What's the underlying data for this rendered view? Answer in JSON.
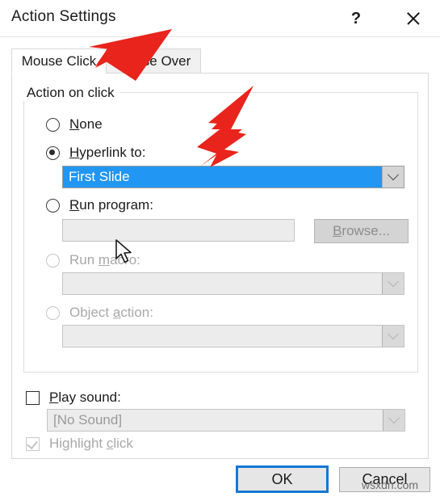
{
  "window": {
    "title": "Action Settings",
    "help_label": "?",
    "close_label": "Close"
  },
  "tabs": [
    {
      "label": "Mouse Click",
      "active": true
    },
    {
      "label": "Mouse Over",
      "active": false
    }
  ],
  "group": {
    "legend": "Action on click"
  },
  "options": [
    {
      "label": "None",
      "accel": "N",
      "selected": false,
      "enabled": true
    },
    {
      "label": "Hyperlink to:",
      "accel": "H",
      "selected": true,
      "enabled": true
    },
    {
      "label": "Run program:",
      "accel": "R",
      "selected": false,
      "enabled": true
    },
    {
      "label": "Run macro:",
      "accel": "m",
      "selected": false,
      "enabled": false
    },
    {
      "label": "Object action:",
      "accel": "a",
      "selected": false,
      "enabled": false
    }
  ],
  "hyperlink_combo": {
    "value": "First Slide",
    "state": "selected-focused"
  },
  "run_program": {
    "value": "",
    "browse_label": "Browse...",
    "browse_accel": "B",
    "enabled": false
  },
  "run_macro_combo": {
    "value": "",
    "enabled": false
  },
  "object_action_combo": {
    "value": "",
    "enabled": false
  },
  "play_sound": {
    "label": "Play sound:",
    "accel": "P",
    "checked": false,
    "enabled": true
  },
  "sound_combo": {
    "value": "[No Sound]",
    "enabled": false
  },
  "highlight_click": {
    "label": "Highlight click",
    "accel": "c",
    "checked": true,
    "enabled": false
  },
  "buttons": {
    "ok": "OK",
    "cancel": "Cancel"
  },
  "annotations": {
    "arrow_color": "#e8241c",
    "arrow_1_target": "Mouse Click tab",
    "arrow_2_target": "Mouse Over tab"
  },
  "watermark": "wsxdn.com",
  "colors": {
    "selection_blue": "#2196f3",
    "focus_blue": "#1478d4",
    "arrow_red": "#e8241c"
  }
}
